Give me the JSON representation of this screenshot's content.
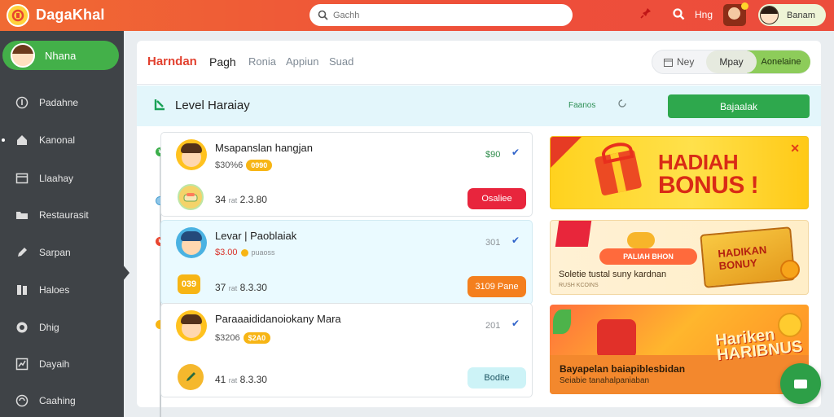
{
  "header": {
    "brand": "DagaKhal",
    "search_placeholder": "Gachh",
    "label": "Hng",
    "user_name": "Banam",
    "accent": "#ee4e3a"
  },
  "sidebar": {
    "profile_name": "Nhana",
    "items": [
      {
        "label": "Padahne",
        "icon": "info-icon"
      },
      {
        "label": "Kanonal",
        "icon": "home-icon"
      },
      {
        "label": "Llaahay",
        "icon": "window-icon"
      },
      {
        "label": "Restaurasit",
        "icon": "folder-icon"
      },
      {
        "label": "Sarpan",
        "icon": "pen-icon"
      },
      {
        "label": "Haloes",
        "icon": "book-icon"
      },
      {
        "label": "Dhig",
        "icon": "clock-icon"
      },
      {
        "label": "Dayaih",
        "icon": "chart-icon"
      },
      {
        "label": "Caahing",
        "icon": "settings-icon"
      }
    ]
  },
  "tabs": [
    {
      "label": "Harndan"
    },
    {
      "label": "Pagh"
    },
    {
      "label": "Ronia"
    },
    {
      "label": "Appiun"
    },
    {
      "label": "Suad"
    }
  ],
  "toggle": {
    "opt1": "Ney",
    "opt2": "Mpay",
    "opt3": "Aonelaine"
  },
  "level": {
    "title": "Level Haraiay",
    "tag": "Faanos",
    "button": "Bajaalak"
  },
  "cards": [
    {
      "name": "Msapanslan hangjan",
      "sub_value": "$30%6",
      "pill": "0990",
      "right_value": "$90",
      "row_value": "34",
      "row_small": "rat",
      "row_value2": "2.3.80",
      "action": "Osaliee",
      "action_color": "red"
    },
    {
      "name": "Levar | Paoblaiak",
      "sub_value": "$3.00",
      "sub_small": "puaoss",
      "right_value": "301",
      "row_badge": "039",
      "row_value": "37",
      "row_small": "rat",
      "row_value2": "8.3.30",
      "action": "3109 Pane",
      "action_color": "orange"
    },
    {
      "name": "Paraaaididanoiokany Mara",
      "sub_value": "$3206",
      "pill": "$2A0",
      "right_value": "201",
      "row_value": "41",
      "row_small": "rat",
      "row_value2": "8.3.30",
      "action": "Bodite",
      "action_color": "cyan"
    }
  ],
  "banners": [
    {
      "line1": "HADIAH",
      "line2": "BONUS !"
    },
    {
      "badge": "PALIAH BHON",
      "box_text": "HADIKAN BONUY",
      "desc": "Soletie tustal suny kardnan",
      "desc2": "RUSH KCOINS"
    },
    {
      "title": "Bayapelan baiapiblesbidan",
      "sub": "Seiabie tanahalpaniaban",
      "bonus1": "Hariken",
      "bonus2": "HARIBNUS"
    }
  ]
}
